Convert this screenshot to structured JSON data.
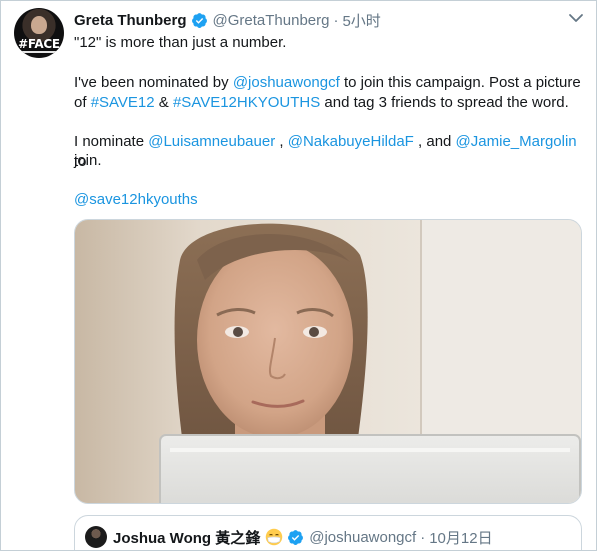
{
  "tweet": {
    "author": {
      "display_name": "Greta Thunberg",
      "handle": "@GretaThunberg",
      "verified": true,
      "avatar_text": "#FACE"
    },
    "separator": "·",
    "timestamp": "5小时",
    "lines": {
      "l1": "\"12\" is more than just a number.",
      "l2a": "I've been nominated by ",
      "l2_mention": "@joshuawongcf",
      "l2b": " to join this campaign. Post a picture",
      "l3a": "of ",
      "l3_hashtag1": "#SAVE12",
      "l3b": " & ",
      "l3_hashtag2": "#SAVE12HKYOUTHS",
      "l3c": " and tag 3 friends to spread the word.",
      "l4a": "I nominate ",
      "l4_mention1": "@Luisamneubauer",
      "l4b": " , ",
      "l4_mention2": "@NakabuyeHildaF",
      "l4c": " , and ",
      "l4_mention3": "@Jamie_Margolin",
      "l4d": " to",
      "l5": "join.",
      "l6_mention": "@save12hkyouths"
    },
    "colors": {
      "link": "#1b95e0",
      "verified": "#1da1f2",
      "muted": "#657786",
      "text": "#14171a"
    }
  },
  "quoted_tweet": {
    "display_name": "Joshua Wong 黃之鋒",
    "emoji": "face-with-medical-mask",
    "verified": true,
    "handle": "@joshuawongcf",
    "separator": "·",
    "timestamp": "10月12日"
  },
  "icons": {
    "more_menu": "chevron-down-icon",
    "verified": "verified-badge-icon"
  }
}
